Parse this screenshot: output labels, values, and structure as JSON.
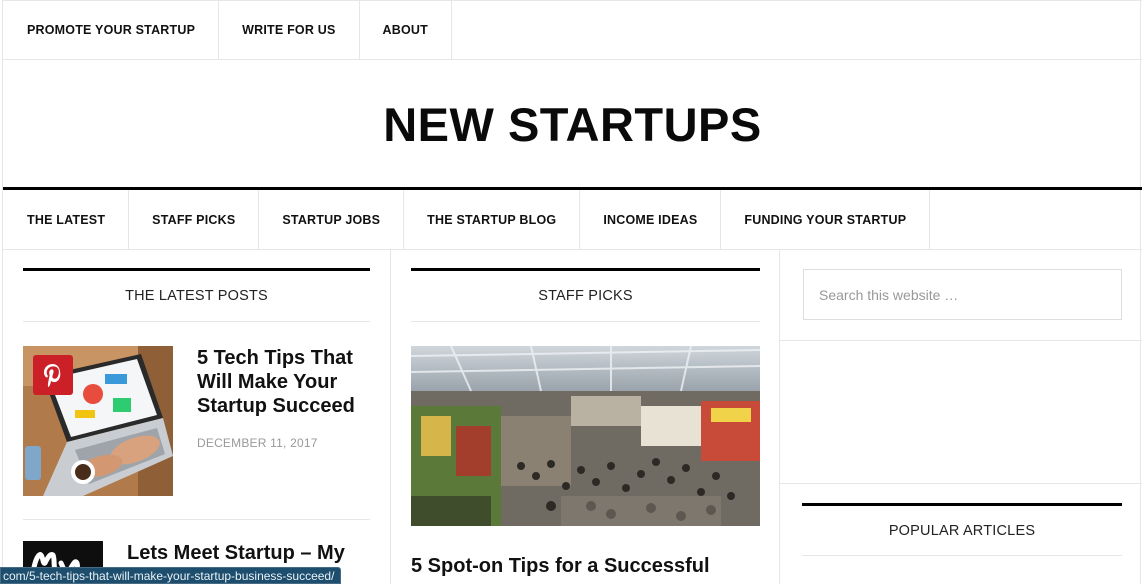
{
  "top_nav": {
    "items": [
      {
        "label": "PROMOTE YOUR STARTUP"
      },
      {
        "label": "WRITE FOR US"
      },
      {
        "label": "ABOUT"
      }
    ]
  },
  "site": {
    "title": "NEW STARTUPS"
  },
  "main_nav": {
    "items": [
      {
        "label": "THE LATEST"
      },
      {
        "label": "STAFF PICKS"
      },
      {
        "label": "STARTUP JOBS"
      },
      {
        "label": "THE STARTUP BLOG"
      },
      {
        "label": "INCOME IDEAS"
      },
      {
        "label": "FUNDING YOUR STARTUP"
      }
    ]
  },
  "latest_posts": {
    "heading": "THE LATEST POSTS",
    "posts": [
      {
        "title_lines": [
          "5 Tech Tips That",
          "Will Make Your",
          "Startup Succeed"
        ],
        "date": "DECEMBER 11, 2017",
        "thumb_icon": "laptop-web-design-image"
      },
      {
        "title_lines": [
          "Lets Meet Startup – My"
        ],
        "thumb_icon": "logo-thumbnail-image"
      }
    ],
    "pin_icon": "pinterest-icon"
  },
  "staff_picks": {
    "heading": "STAFF PICKS",
    "image_icon": "trade-show-crowd-image",
    "post_title": "5 Spot-on Tips for a Successful"
  },
  "sidebar": {
    "search_placeholder": "Search this website …",
    "popular_heading": "POPULAR ARTICLES"
  },
  "status_bar": {
    "url": "com/5-tech-tips-that-will-make-your-startup-business-succeed/"
  },
  "colors": {
    "accent_black": "#000000",
    "pinterest_red": "#cb2027",
    "divider": "#e6e6e6",
    "date_gray": "#999999",
    "status_bar_bg": "#1e4e6e"
  }
}
